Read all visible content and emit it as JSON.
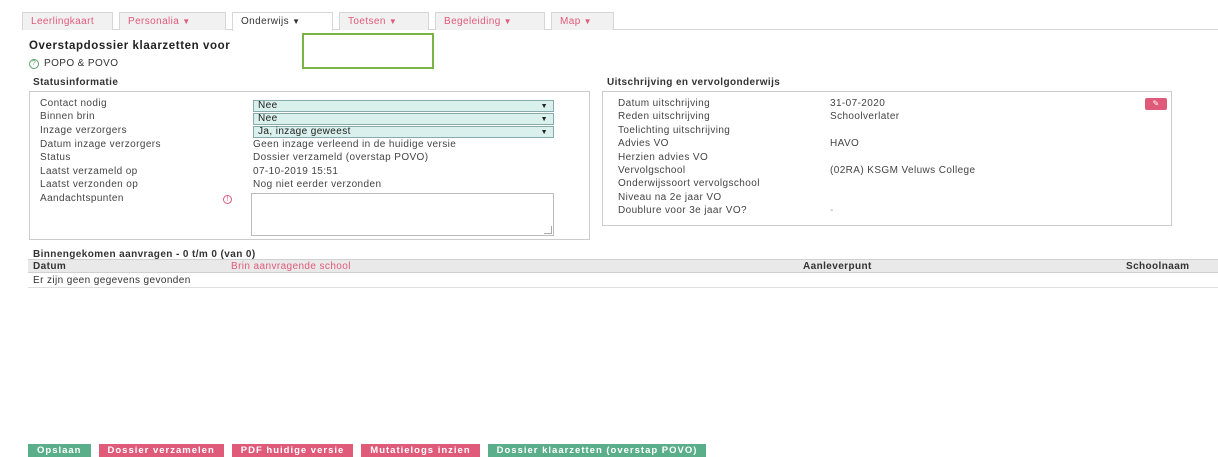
{
  "tabs": [
    {
      "label": "Leerlingkaart",
      "caret": false,
      "active": false
    },
    {
      "label": "Personalia",
      "caret": true,
      "active": false
    },
    {
      "label": "Onderwijs",
      "caret": true,
      "active": true
    },
    {
      "label": "Toetsen",
      "caret": true,
      "active": false
    },
    {
      "label": "Begeleiding",
      "caret": true,
      "active": false
    },
    {
      "label": "Map",
      "caret": true,
      "active": false
    }
  ],
  "caret_glyph": "▼",
  "page": {
    "title": "Overstapdossier klaarzetten voor",
    "subtitle": "POPO & POVO",
    "subtitle_icon": "?"
  },
  "status": {
    "heading": "Statusinformatie",
    "contact_label": "Contact nodig",
    "contact_value": "Nee",
    "brin_label": "Binnen brin",
    "brin_value": "Nee",
    "inzage_label": "Inzage verzorgers",
    "inzage_value": "Ja, inzage geweest",
    "datum_inzage_label": "Datum inzage verzorgers",
    "datum_inzage_value": "Geen inzage verleend in de huidige versie",
    "status_label": "Status",
    "status_value": "Dossier verzameld (overstap POVO)",
    "verzameld_label": "Laatst verzameld op",
    "verzameld_value": "07-10-2019 15:51",
    "verzonden_label": "Laatst verzonden op",
    "verzonden_value": "Nog niet eerder verzonden",
    "aandacht_label": "Aandachtspunten",
    "aandacht_value": "",
    "alert_glyph": "!"
  },
  "uitschrijving": {
    "heading": "Uitschrijving en vervolgonderwijs",
    "rows": [
      {
        "label": "Datum uitschrijving",
        "value": "31-07-2020"
      },
      {
        "label": "Reden uitschrijving",
        "value": "Schoolverlater"
      },
      {
        "label": "Toelichting uitschrijving",
        "value": ""
      },
      {
        "label": "Advies VO",
        "value": "HAVO"
      },
      {
        "label": "Herzien advies VO",
        "value": ""
      },
      {
        "label": "Vervolgschool",
        "value": "(02RA) KSGM Veluws College"
      },
      {
        "label": "Onderwijssoort vervolgschool",
        "value": ""
      },
      {
        "label": "Niveau na 2e jaar VO",
        "value": ""
      },
      {
        "label": "Doublure voor 3e jaar VO?",
        "value": "-"
      }
    ]
  },
  "aanvragen": {
    "heading": "Binnengekomen aanvragen - 0 t/m 0 (van 0)",
    "columns": [
      "Datum",
      "Brin aanvragende school",
      "Aanleverpunt",
      "Schoolnaam"
    ],
    "empty": "Er zijn geen gegevens gevonden"
  },
  "footer": {
    "opslaan": "Opslaan",
    "verzamelen": "Dossier verzamelen",
    "pdf": "PDF huidige versie",
    "mutatielogs": "Mutatielogs inzien",
    "klaarzetten": "Dossier klaarzetten (overstap POVO)"
  },
  "colors": {
    "accent": "#e05a7a",
    "green": "#5aaf8a",
    "highlight": "#79b448",
    "select_bg": "#d9f0ec"
  }
}
